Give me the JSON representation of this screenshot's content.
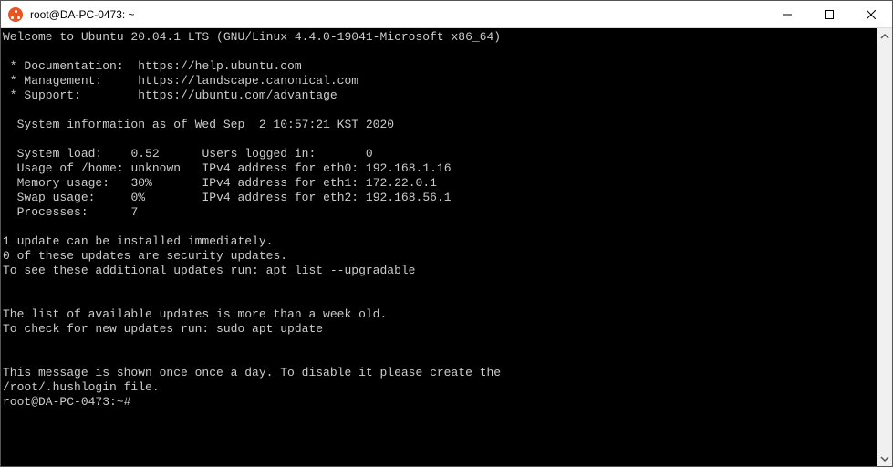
{
  "window": {
    "title": "root@DA-PC-0473: ~"
  },
  "motd": {
    "welcome": "Welcome to Ubuntu 20.04.1 LTS (GNU/Linux 4.4.0-19041-Microsoft x86_64)",
    "links": {
      "documentation_label": " * Documentation:",
      "documentation_url": "https://help.ubuntu.com",
      "management_label": " * Management:",
      "management_url": "https://landscape.canonical.com",
      "support_label": " * Support:",
      "support_url": "https://ubuntu.com/advantage"
    },
    "sysinfo_header": "  System information as of Wed Sep  2 10:57:21 KST 2020",
    "sysinfo": {
      "load_label": "  System load:",
      "load_value": "0.52",
      "users_label": "Users logged in:",
      "users_value": "0",
      "homeusage_label": "  Usage of /home:",
      "homeusage_value": "unknown",
      "ip0_label": "IPv4 address for eth0:",
      "ip0_value": "192.168.1.16",
      "mem_label": "  Memory usage:",
      "mem_value": "30%",
      "ip1_label": "IPv4 address for eth1:",
      "ip1_value": "172.22.0.1",
      "swap_label": "  Swap usage:",
      "swap_value": "0%",
      "ip2_label": "IPv4 address for eth2:",
      "ip2_value": "192.168.56.1",
      "proc_label": "  Processes:",
      "proc_value": "7"
    },
    "updates_line1": "1 update can be installed immediately.",
    "updates_line2": "0 of these updates are security updates.",
    "updates_line3": "To see these additional updates run: apt list --upgradable",
    "stale_line1": "The list of available updates is more than a week old.",
    "stale_line2": "To check for new updates run: sudo apt update",
    "hush_line1": "This message is shown once once a day. To disable it please create the",
    "hush_line2": "/root/.hushlogin file."
  },
  "prompt": {
    "userhost": "root@DA-PC-0473",
    "path": "~",
    "symbol": "#"
  }
}
